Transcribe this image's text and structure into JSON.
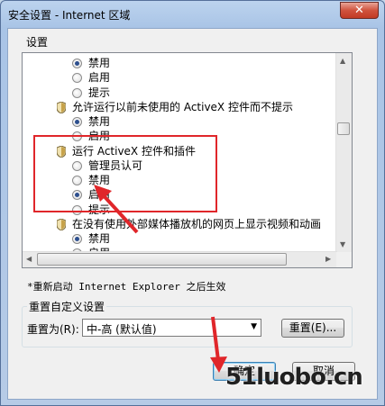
{
  "window": {
    "title": "安全设置 - Internet 区域",
    "close_label": "✕"
  },
  "settings_label": "设置",
  "list": {
    "rows": [
      {
        "kind": "radio",
        "label": "禁用",
        "checked": true
      },
      {
        "kind": "radio",
        "label": "启用",
        "checked": false
      },
      {
        "kind": "radio",
        "label": "提示",
        "checked": false
      },
      {
        "kind": "header",
        "label": "允许运行以前未使用的 ActiveX 控件而不提示"
      },
      {
        "kind": "radio",
        "label": "禁用",
        "checked": true
      },
      {
        "kind": "radio",
        "label": "启用",
        "checked": false
      },
      {
        "kind": "header",
        "label": "运行 ActiveX 控件和插件"
      },
      {
        "kind": "radio",
        "label": "管理员认可",
        "checked": false
      },
      {
        "kind": "radio",
        "label": "禁用",
        "checked": false
      },
      {
        "kind": "radio",
        "label": "启用",
        "checked": true
      },
      {
        "kind": "radio",
        "label": "提示",
        "checked": false
      },
      {
        "kind": "header",
        "label": "在没有使用外部媒体播放机的网页上显示视频和动画"
      },
      {
        "kind": "radio",
        "label": "禁用",
        "checked": true
      },
      {
        "kind": "radio",
        "label": "启用",
        "checked": false
      }
    ]
  },
  "restart_note": "*重新启动 Internet Explorer 之后生效",
  "reset_group": {
    "title": "重置自定义设置",
    "reset_to_label": "重置为(R):",
    "selected_value": "中-高 (默认值)",
    "reset_button": "重置(E)..."
  },
  "buttons": {
    "ok": "确定",
    "cancel": "取消"
  },
  "watermark": "51luobo.cn",
  "colors": {
    "highlight": "#e0262a",
    "title_bar": "#bcd3ee"
  }
}
